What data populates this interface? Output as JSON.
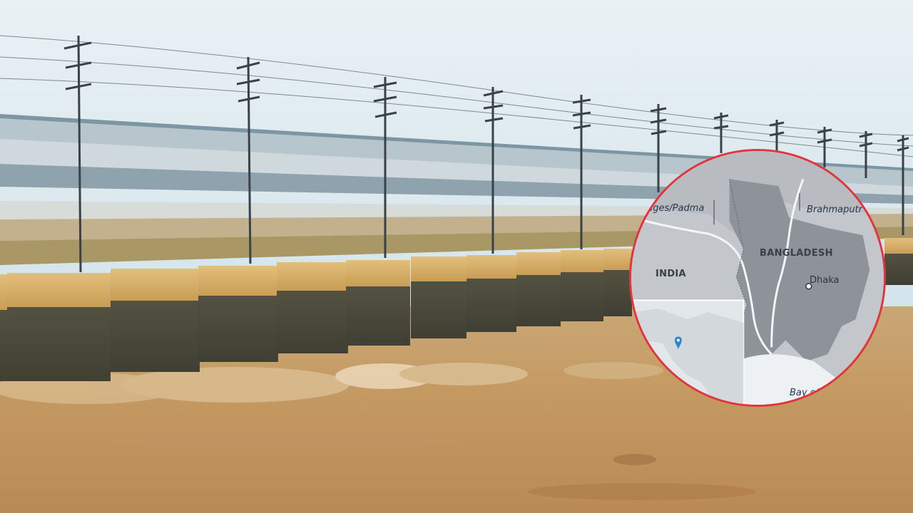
{
  "map_inset": {
    "labels": {
      "river_ganges": "nges/Padma",
      "river_brahmaputra": "Brahmaputr",
      "country_india": "INDIA",
      "country_bangladesh": "BANGLADESH",
      "city_dhaka": "Dhaka",
      "bay": "Bay of"
    },
    "colors": {
      "border": "#e2343a",
      "land_bangladesh": "#8d9399",
      "land_india": "#b6babf",
      "water": "#eef1f4",
      "pin": "#2f86c6"
    }
  },
  "scene": {
    "description_icons": [
      "barrage-bridge",
      "electric-pole",
      "river-water"
    ]
  }
}
